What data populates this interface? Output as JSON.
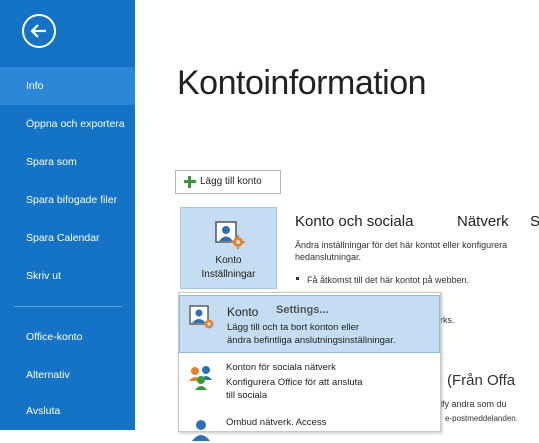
{
  "sidebar": {
    "back_icon": "back-arrow-icon",
    "items": [
      {
        "label": "Info",
        "active": true
      },
      {
        "label": "Öppna och exportera"
      },
      {
        "label": "Spara som"
      },
      {
        "label": "Spara bifogade filer"
      },
      {
        "label": "Spara Calendar"
      },
      {
        "label": "Skriv ut"
      },
      {
        "label": "Office-konto"
      },
      {
        "label": "Alternativ"
      },
      {
        "label": "Avsluta"
      }
    ],
    "bg_color": "#1473c5",
    "active_color": "#2b88d8"
  },
  "main": {
    "title": "Kontoinformation",
    "add_account_label": "Lägg till konto",
    "settings_tile": {
      "line1": "Konto",
      "line2": "Inställningar"
    },
    "section": {
      "title": "Konto och sociala",
      "title2": "Nätverk",
      "title3": "S",
      "description": "Ändra inställningar för det här kontot eller konfigurera hedanslutningar.",
      "bullet": "Få åtkomst till det här kontot på webben.",
      "partial_1": "rks.",
      "partial_2": "(Från Offa",
      "partial_3": "ify andra som du",
      "partial_4": "e-postmeddelanden."
    }
  },
  "dropdown": {
    "hint": "Settings...",
    "items": [
      {
        "title": "Konto",
        "desc1": "Lägg till och ta bort konton eller",
        "desc2": "ändra befintliga anslutningsinställningar.",
        "icon": "account-settings-icon",
        "highlighted": true
      },
      {
        "title": "Konton för sociala nätverk",
        "desc1": "Konfigurera Office för att ansluta",
        "desc2": "till sociala",
        "icon": "social-network-icon"
      },
      {
        "title": "Ombud nätverk. Access",
        "icon": "delegate-access-icon"
      }
    ]
  }
}
